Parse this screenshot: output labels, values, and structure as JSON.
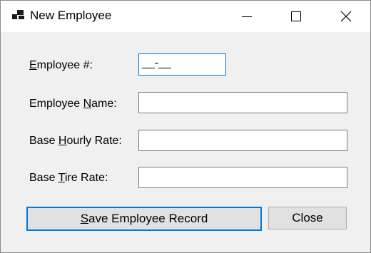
{
  "window": {
    "title": "New Employee"
  },
  "form": {
    "employee_number": {
      "label_pre": "",
      "label_accel": "E",
      "label_post": "mployee #:",
      "value": "__-__"
    },
    "employee_name": {
      "label_pre": "Employee ",
      "label_accel": "N",
      "label_post": "ame:",
      "value": ""
    },
    "base_hourly_rate": {
      "label_pre": "Base ",
      "label_accel": "H",
      "label_post": "ourly Rate:",
      "value": ""
    },
    "base_tire_rate": {
      "label_pre": "Base ",
      "label_accel": "T",
      "label_post": "ire Rate:",
      "value": ""
    }
  },
  "buttons": {
    "save": {
      "pre": "",
      "accel": "S",
      "post": "ave Employee Record"
    },
    "close": {
      "label": "Close"
    }
  }
}
